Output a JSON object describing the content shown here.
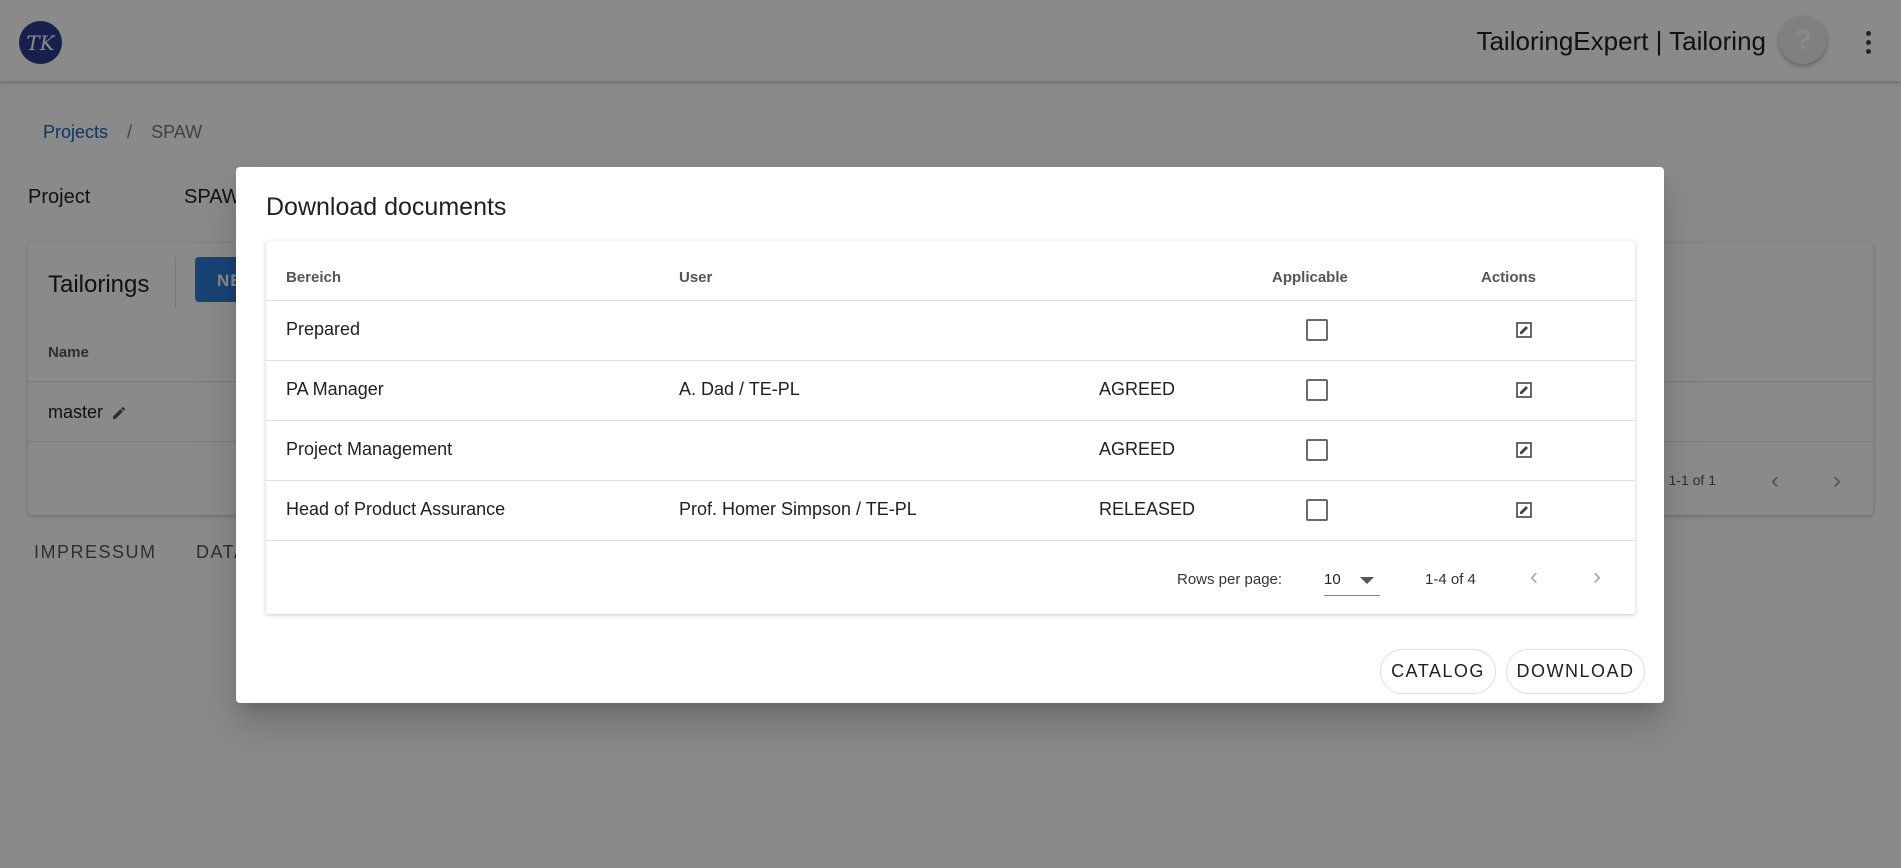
{
  "app": {
    "logo_text": "TK",
    "title": "TailoringExpert | Tailoring",
    "help_icon_glyph": "?"
  },
  "breadcrumb": {
    "projects": "Projects",
    "separator": "/",
    "current": "SPAW"
  },
  "project": {
    "label": "Project",
    "value": "SPAW"
  },
  "tailorings": {
    "title": "Tailorings",
    "new_button": "NE",
    "column_name": "Name",
    "rows": [
      {
        "name": "master"
      }
    ],
    "range": "1-1 of 1"
  },
  "footer": {
    "impressum": "IMPRESSUM",
    "data": "DATA"
  },
  "dialog": {
    "title": "Download documents",
    "columns": {
      "bereich": "Bereich",
      "user": "User",
      "applicable": "Applicable",
      "actions": "Actions"
    },
    "rows": [
      {
        "bereich": "Prepared",
        "user": "",
        "status": "",
        "applicable": false
      },
      {
        "bereich": "PA Manager",
        "user": "A. Dad / TE-PL",
        "status": "AGREED",
        "applicable": false
      },
      {
        "bereich": "Project Management",
        "user": "",
        "status": "AGREED",
        "applicable": false
      },
      {
        "bereich": "Head of Product Assurance",
        "user": "Prof. Homer Simpson / TE-PL",
        "status": "RELEASED",
        "applicable": false
      }
    ],
    "pagination": {
      "rows_per_page_label": "Rows per page:",
      "rows_per_page": "10",
      "range": "1-4 of 4"
    },
    "buttons": {
      "catalog": "CATALOG",
      "download": "DOWNLOAD"
    }
  },
  "icons": {
    "edit": "pencil-icon",
    "row_action": "edit-box-icon",
    "prev": "chevron-left-icon",
    "next": "chevron-right-icon",
    "menu": "more-vertical-icon",
    "help": "help-icon"
  },
  "colors": {
    "primary": "#2f7ad8",
    "link": "#1a63b0",
    "logo": "#2c3b8f",
    "scrim": "rgba(0,0,0,0.46)"
  }
}
